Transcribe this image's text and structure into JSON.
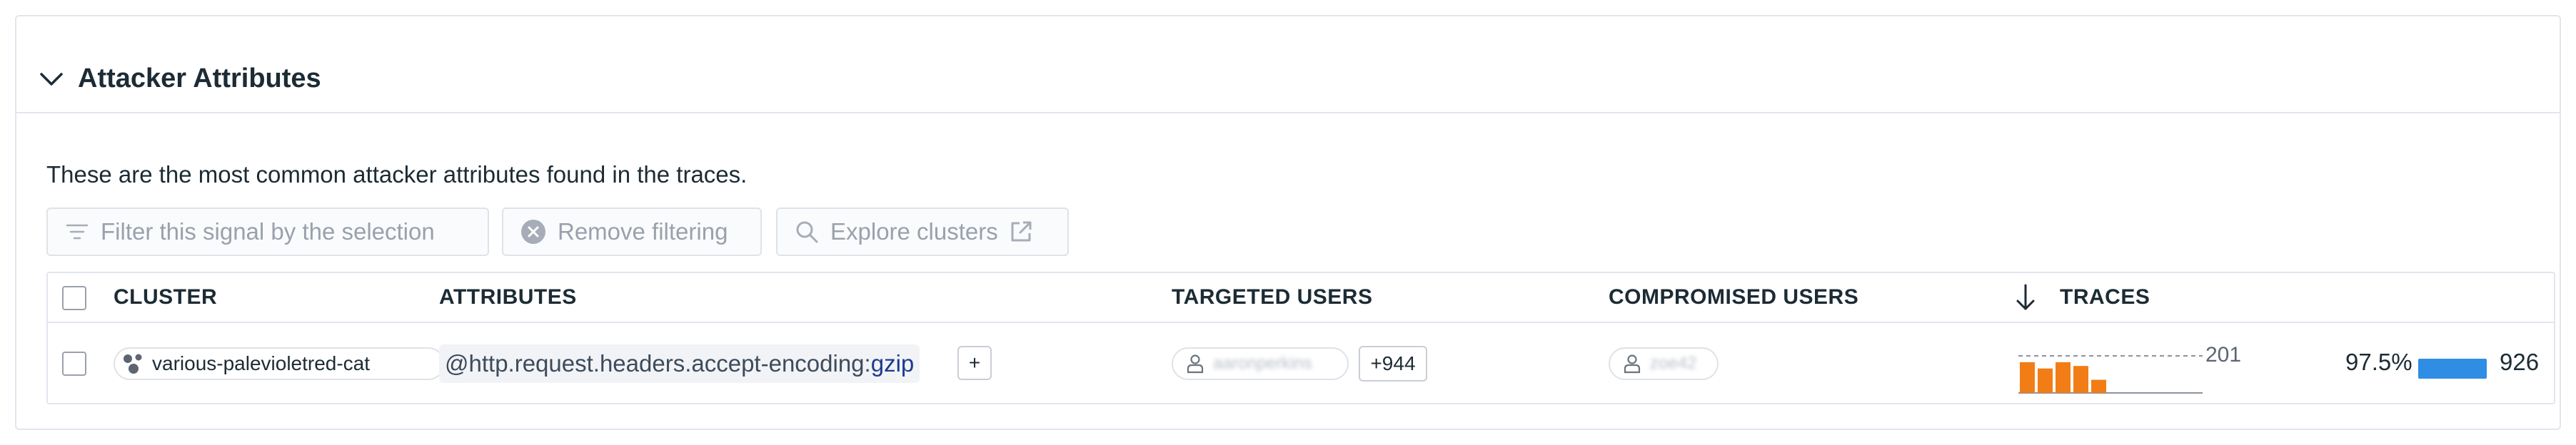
{
  "section": {
    "title": "Attacker Attributes",
    "description": "These are the most common attacker attributes found in the traces."
  },
  "toolbar": {
    "filter_label": "Filter this signal by the selection",
    "remove_label": "Remove filtering",
    "explore_label": "Explore clusters"
  },
  "table": {
    "columns": {
      "cluster": "CLUSTER",
      "attributes": "ATTRIBUTES",
      "targeted_users": "TARGETED USERS",
      "compromised_users": "COMPROMISED USERS",
      "traces": "TRACES"
    },
    "rows": [
      {
        "cluster": "various-palevioletred-cat",
        "attribute_key": "@http.request.headers.accept-encoding:",
        "attribute_value": "gzip",
        "add_label": "+",
        "targeted_user": "aaronperkins",
        "targeted_more": "+944",
        "compromised_user": "zoe42",
        "sparkline_max": "201",
        "sparkline": [
          0.98,
          0.78,
          0.98,
          0.86,
          0.42
        ],
        "percent": "97.5%",
        "percent_fraction": 0.975,
        "traces": "926"
      }
    ]
  },
  "colors": {
    "sparkline_bar": "#f27d16",
    "traces_bar": "#2f8de4",
    "text": "#1c2b34",
    "border": "#e2e5ed"
  },
  "icons": {
    "collapse": "chevron-down-icon",
    "filter": "filter-lines-icon",
    "remove": "x-circle-icon",
    "explore": "search-icon",
    "external": "external-link-icon",
    "cluster": "cluster-dots-icon",
    "user": "user-icon",
    "sort": "arrow-down-icon"
  }
}
